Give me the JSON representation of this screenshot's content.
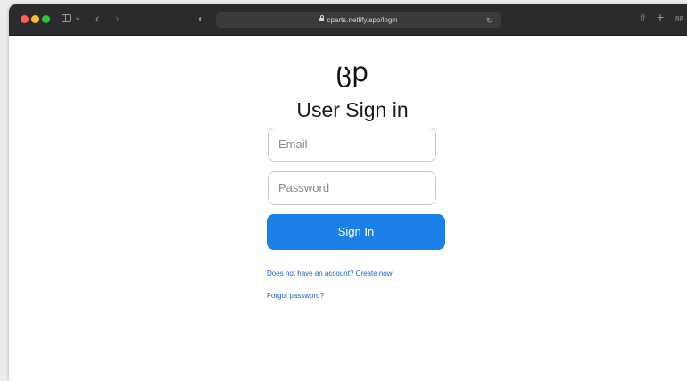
{
  "browser": {
    "url": "cparts.netlify.app/login",
    "icons": [
      "sidebar-icon",
      "chevron-down-icon",
      "back-icon",
      "forward-icon",
      "privacy-icon",
      "lock-icon",
      "reload-icon",
      "share-icon",
      "new-tab-icon",
      "tab-overview-icon"
    ],
    "glyphs": {
      "chevron_down": "⌄",
      "back": "‹",
      "forward": "›",
      "privacy": "◐",
      "reload": "↻",
      "share": "⇧",
      "new_tab": "+",
      "tab_overview": "88"
    }
  },
  "page": {
    "logo_text": "ცp",
    "title": "User Sign in",
    "email_placeholder": "Email",
    "password_placeholder": "Password",
    "signin_label": "Sign In",
    "create_link": "Does not have an account? Create now",
    "forgot_link": "Forgot password?"
  },
  "colors": {
    "primary_button": "#1a7fe6",
    "link": "#1a63c9",
    "toolbar": "#2b2b2d"
  }
}
